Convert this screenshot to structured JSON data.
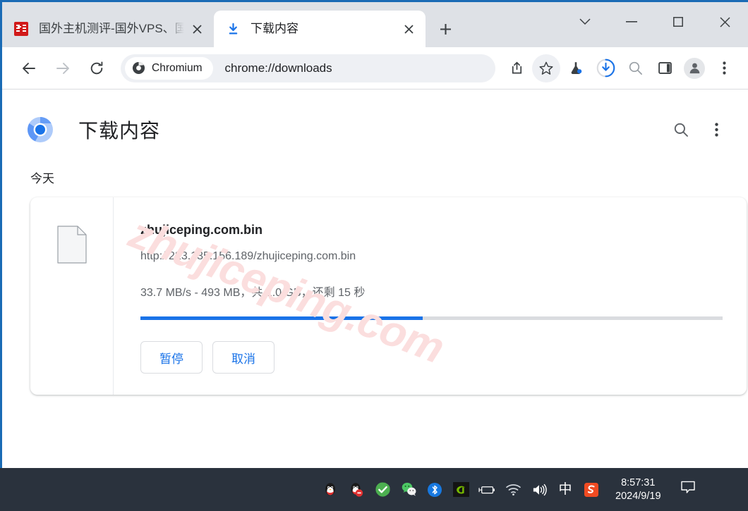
{
  "window": {
    "controls": {
      "tab_search_label": "tab-search",
      "minimize_label": "minimize",
      "maximize_label": "maximize",
      "close_label": "close"
    }
  },
  "tabs": [
    {
      "title": "国外主机测评-国外VPS、国",
      "favicon": "red-site-icon",
      "active": false,
      "close_label": "×"
    },
    {
      "title": "下载内容",
      "favicon": "download-icon",
      "active": true,
      "close_label": "×"
    }
  ],
  "new_tab_label": "+",
  "toolbar": {
    "back_label": "back-arrow-icon",
    "forward_label": "forward-arrow-icon",
    "reload_label": "reload-icon",
    "chip_label": "Chromium",
    "url": "chrome://downloads",
    "share_label": "share-icon",
    "bookmark_label": "star-icon",
    "experiments_label": "flask-icon",
    "downloads_label": "download-progress-icon",
    "search_label": "search-icon",
    "side_panel_label": "side-panel-icon",
    "profile_label": "avatar-icon",
    "menu_label": "three-dot-menu-icon"
  },
  "page": {
    "logo": "chromium-logo",
    "title": "下载内容",
    "search_label": "search-icon",
    "menu_label": "three-dot-menu-icon",
    "date_group": "今天"
  },
  "download": {
    "file_icon": "generic-file-icon",
    "file_name": "zhujiceping.com.bin",
    "url": "http://223.135.156.189/zhujiceping.com.bin",
    "status": "33.7 MB/s - 493 MB，共 1.0 GB，还剩 15 秒",
    "progress_percent": 48.5,
    "progress_fill_color": "#1a73e8",
    "progress_track_color": "#dadce0",
    "buttons": {
      "pause": "暂停",
      "cancel": "取消"
    }
  },
  "watermark": {
    "text": "zhujiceping.com",
    "color": "#fbdede"
  },
  "taskbar": {
    "tray_icons": [
      "qq-penguin-icon",
      "qq-penguin-offline-icon",
      "green-check-icon",
      "wechat-icon",
      "bluetooth-icon",
      "nvidia-icon",
      "battery-icon",
      "wifi-icon",
      "volume-icon",
      "ime-chinese-icon",
      "sogou-icon"
    ],
    "ime_label": "中",
    "sogou_label": "S",
    "time": "8:57:31",
    "date": "2024/9/19",
    "notification_label": "notification-icon"
  }
}
